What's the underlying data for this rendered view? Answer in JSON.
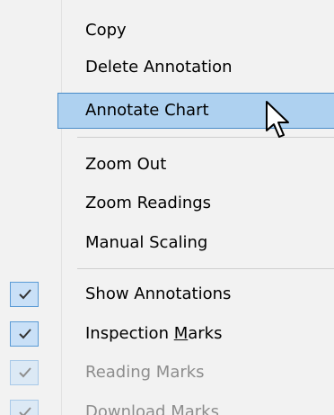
{
  "context_menu": {
    "items": [
      {
        "label": "Copy"
      },
      {
        "label": "Delete Annotation"
      },
      {
        "label": "Annotate Chart",
        "state": "highlighted"
      },
      {
        "label": "Zoom Out"
      },
      {
        "label": "Zoom Readings"
      },
      {
        "label": "Manual Scaling"
      },
      {
        "label": "Show Annotations",
        "checked": true
      },
      {
        "label": "Inspection Marks",
        "checked": true,
        "mnemonic": "M"
      },
      {
        "label": "Reading Marks",
        "checked": true,
        "enabled": false
      },
      {
        "label": "Download Marks",
        "checked": true,
        "enabled": false
      }
    ]
  },
  "colors": {
    "highlight_fill": "#aed1f0",
    "highlight_border": "#4a8cc8",
    "check_fill": "#c9e0f7",
    "check_border": "#5b9bd5",
    "disabled_text": "#8d8d8d"
  }
}
